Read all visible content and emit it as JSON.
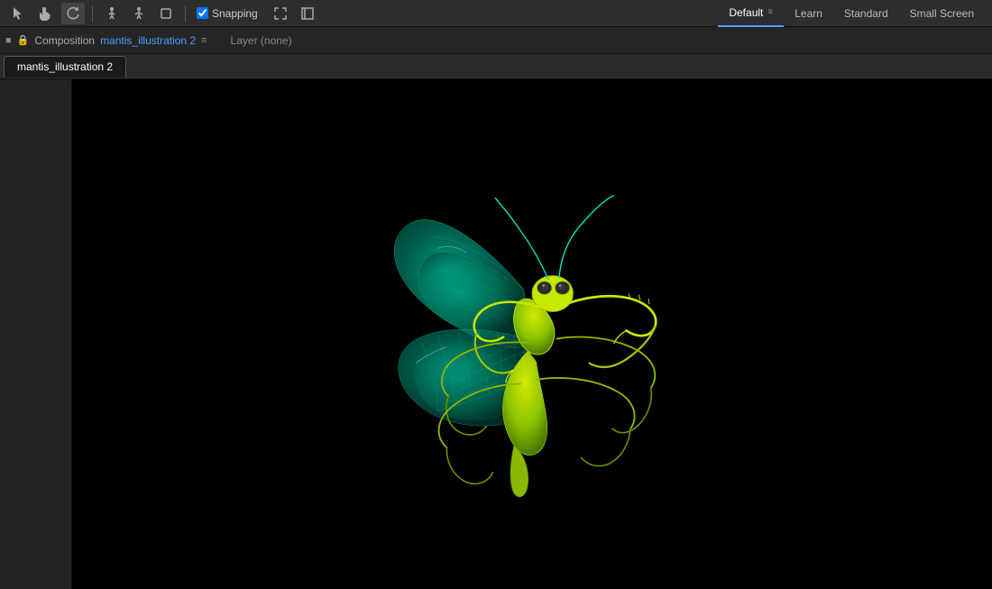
{
  "topToolbar": {
    "tools": [
      {
        "name": "select-tool",
        "icon": "◈",
        "active": false
      },
      {
        "name": "hand-tool",
        "icon": "✥",
        "active": false
      },
      {
        "name": "rotate-tool",
        "icon": "↻",
        "active": false
      }
    ],
    "snapping": {
      "label": "Snapping",
      "checked": true
    },
    "expandIcon": "⤢",
    "fullscreenIcon": "⛶",
    "workspaces": [
      {
        "id": "default",
        "label": "Default",
        "active": true,
        "hasMenu": true
      },
      {
        "id": "learn",
        "label": "Learn",
        "active": false,
        "hasMenu": false
      },
      {
        "id": "standard",
        "label": "Standard",
        "active": false,
        "hasMenu": false
      },
      {
        "id": "small-screen",
        "label": "Small Screen",
        "active": false,
        "hasMenu": false
      }
    ]
  },
  "compBar": {
    "prefix": "Composition",
    "compName": "mantis_illustration 2",
    "layerInfo": "Layer (none)"
  },
  "tabs": [
    {
      "id": "comp-tab",
      "label": "mantis_illustration 2",
      "active": true
    }
  ],
  "canvas": {
    "bgColor": "#000000"
  }
}
